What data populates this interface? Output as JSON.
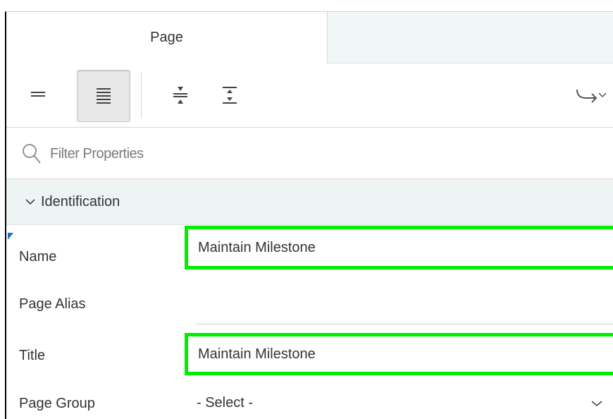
{
  "tabs": [
    {
      "label": "Page",
      "active": true
    }
  ],
  "toolbar": {
    "buttons": [
      {
        "name": "show-common-icon",
        "active": false
      },
      {
        "name": "show-all-icon",
        "active": true
      },
      {
        "name": "collapse-all-icon",
        "active": false
      },
      {
        "name": "expand-all-icon",
        "active": false
      },
      {
        "name": "go-to-group-icon",
        "active": false
      }
    ]
  },
  "filter": {
    "placeholder": "Filter Properties",
    "value": ""
  },
  "section": {
    "title": "Identification",
    "expanded": true
  },
  "properties": {
    "name": {
      "label": "Name",
      "value": "Maintain Milestone"
    },
    "alias": {
      "label": "Page Alias",
      "value": ""
    },
    "title": {
      "label": "Title",
      "value": "Maintain Milestone"
    },
    "group": {
      "label": "Page Group",
      "value": "- Select -"
    }
  },
  "colors": {
    "highlight": "#00ee00",
    "tab_inactive_bg": "#f1f7f7",
    "section_bg": "#eef4f4",
    "marker": "#1f6fbf"
  }
}
